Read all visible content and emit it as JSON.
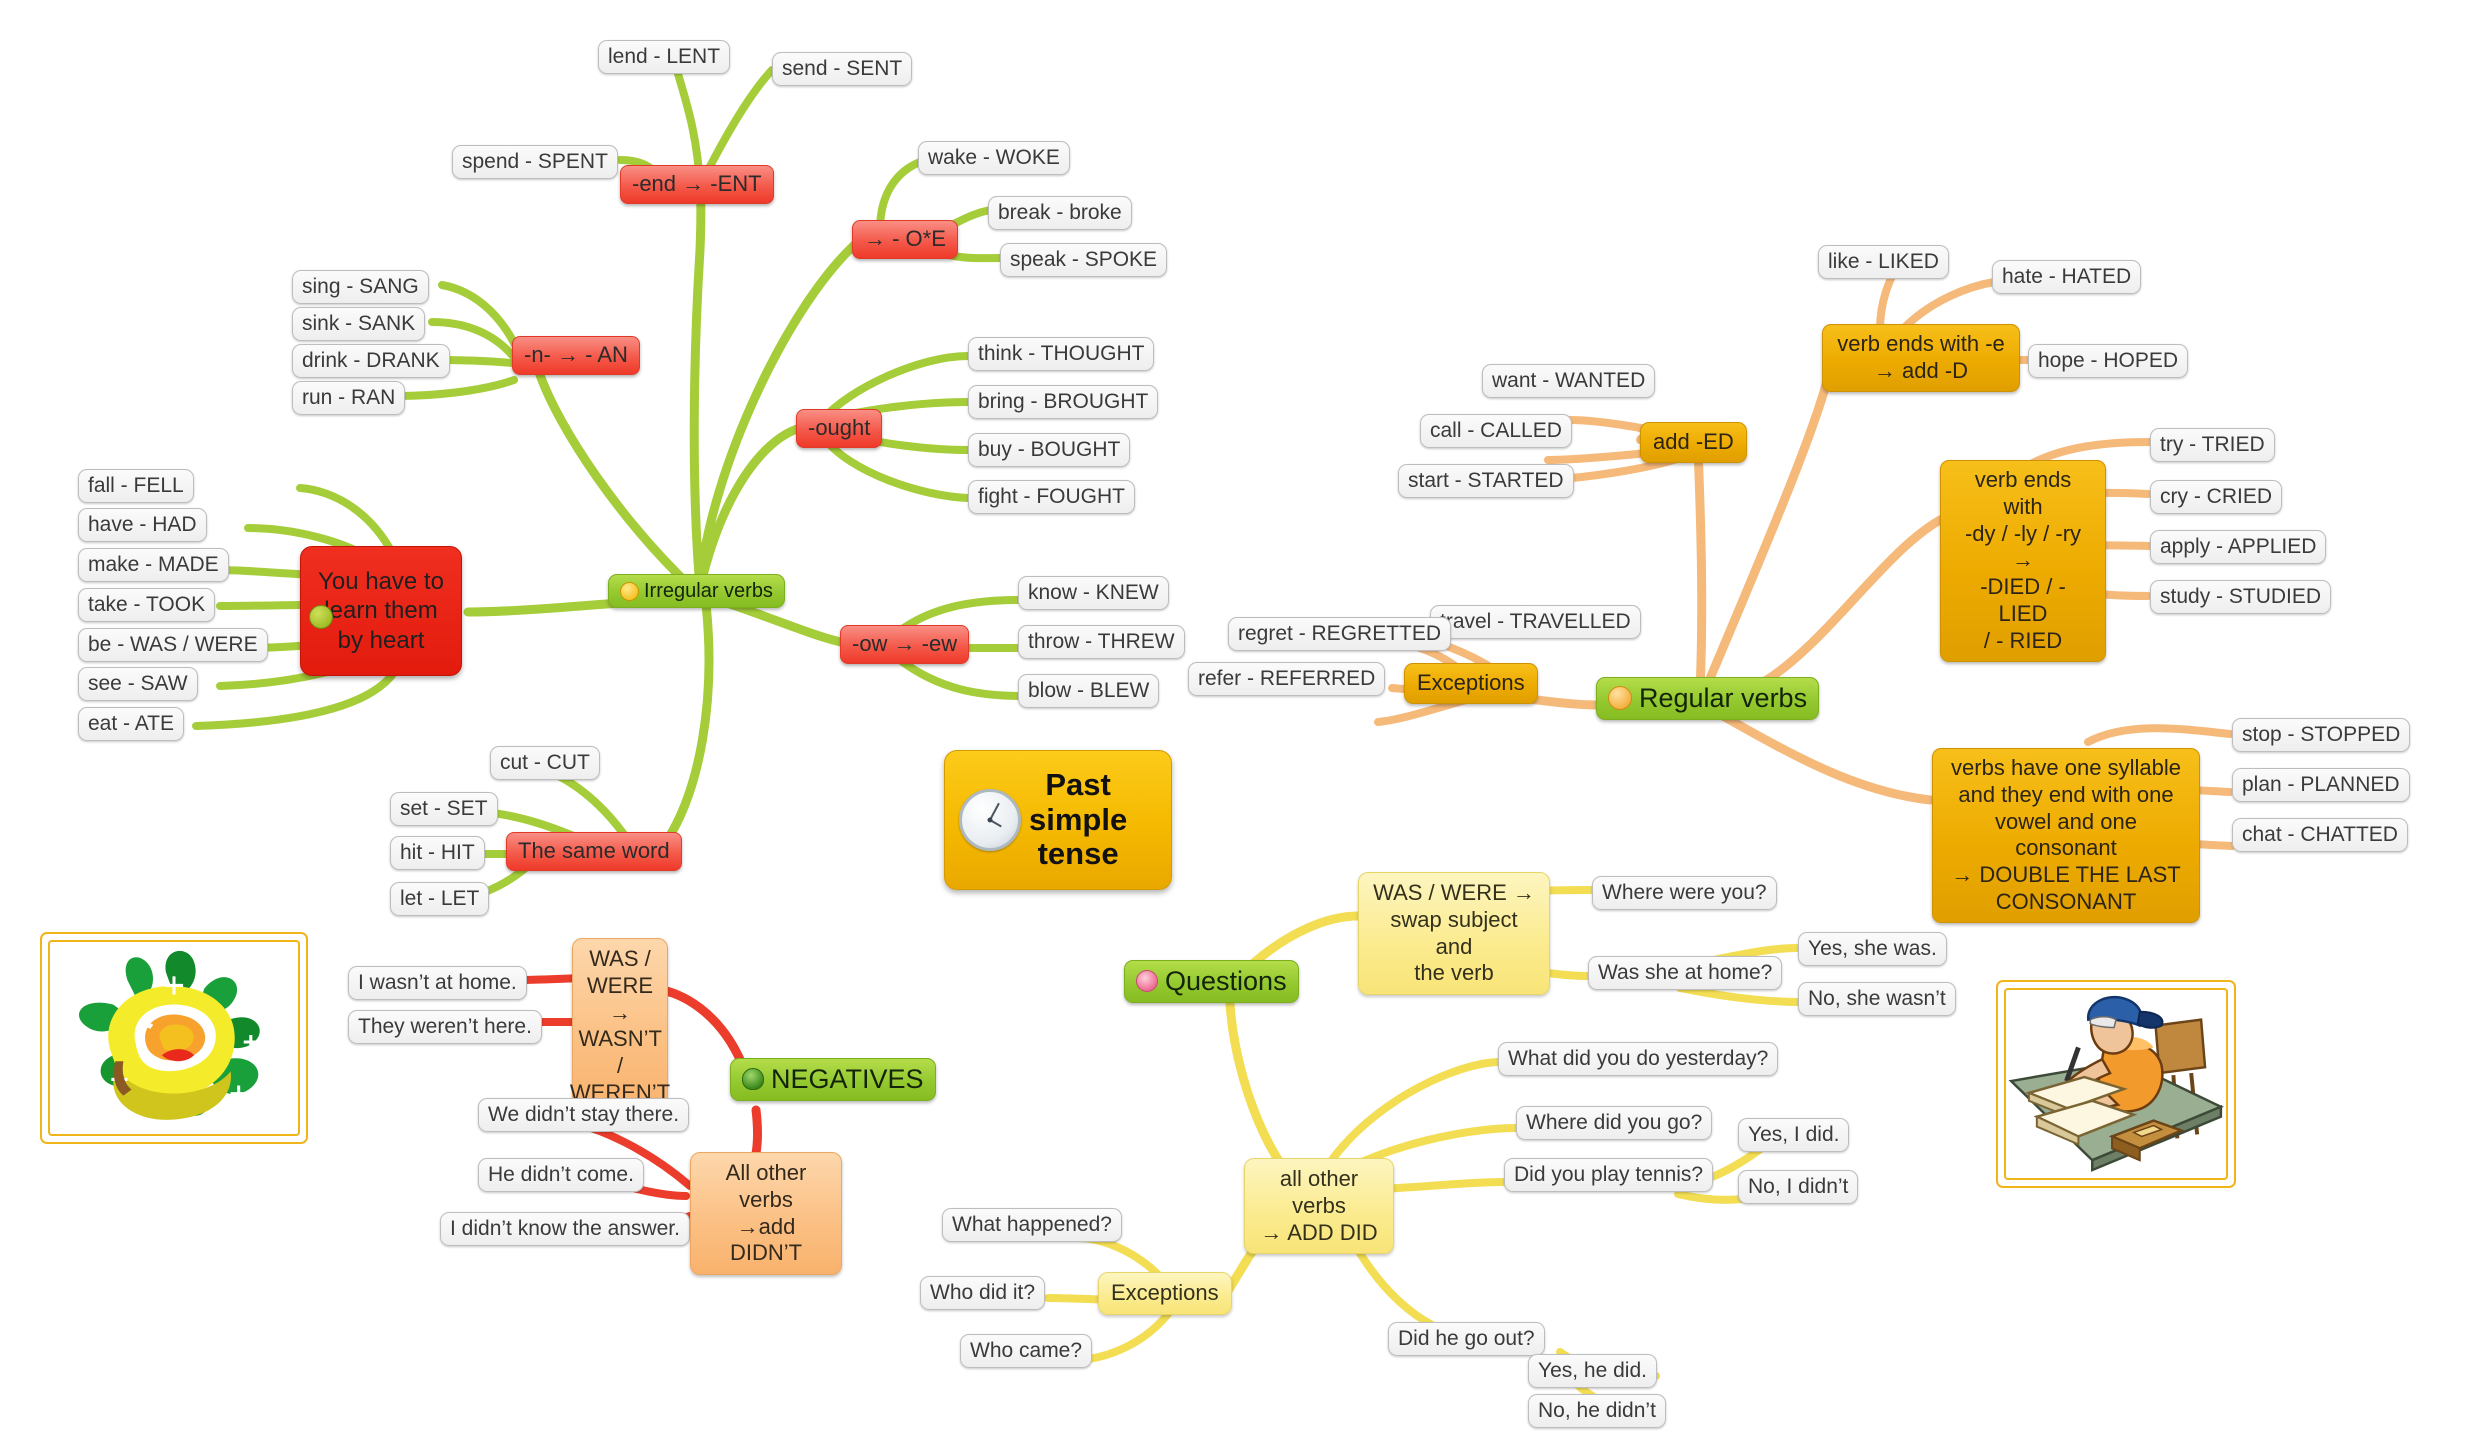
{
  "root": {
    "label": "Past simple tense",
    "icon": "clock-icon"
  },
  "branches": {
    "irregular": {
      "label": "Irregular verbs",
      "icon": "smiley-icon",
      "color": "#94c930",
      "groups": [
        {
          "label": "-end → -ENT",
          "children": [
            "lend - LENT",
            "send - SENT",
            "spend - SPENT"
          ]
        },
        {
          "label": "→ - O*E",
          "children": [
            "wake - WOKE",
            "break - broke",
            "speak - SPOKE"
          ]
        },
        {
          "label": "-n- → - AN",
          "children": [
            "sing - SANG",
            "sink - SANK",
            "drink - DRANK",
            "run - RAN"
          ]
        },
        {
          "label": "-ought",
          "children": [
            "think - THOUGHT",
            "bring - BROUGHT",
            "buy - BOUGHT",
            "fight - FOUGHT"
          ]
        },
        {
          "label": "You have to learn them by heart",
          "icon": "sad-face-icon",
          "children": [
            "fall - FELL",
            "have - HAD",
            "make - MADE",
            "take - TOOK",
            "be - WAS / WERE",
            "see - SAW",
            "eat - ATE"
          ]
        },
        {
          "label": "-ow → -ew",
          "children": [
            "know - KNEW",
            "throw - THREW",
            "blow - BLEW"
          ]
        },
        {
          "label": "The same word",
          "children": [
            "cut - CUT",
            "set - SET",
            "hit - HIT",
            "let - LET"
          ]
        }
      ]
    },
    "regular": {
      "label": "Regular verbs",
      "icon": "orange-ball-icon",
      "color": "#94c930",
      "groups": [
        {
          "label": "add -ED",
          "children": [
            "want - WANTED",
            "call - CALLED",
            "start - STARTED"
          ]
        },
        {
          "label": "verb ends with -e → add -D",
          "children": [
            "like - LIKED",
            "hate - HATED",
            "hope - HOPED"
          ]
        },
        {
          "label": "verb ends with -dy / -ly / -ry → -DIED / - LIED / - RIED",
          "children": [
            "try - TRIED",
            "cry - CRIED",
            "apply - APPLIED",
            "study - STUDIED"
          ]
        },
        {
          "label": "verbs have one syllable and they end with one vowel and one consonant → DOUBLE THE LAST CONSONANT",
          "children": [
            "stop - STOPPED",
            "plan - PLANNED",
            "chat - CHATTED"
          ]
        },
        {
          "label": "Exceptions",
          "children": [
            "travel - TRAVELLED",
            "regret - REGRETTED",
            "refer - REFERRED"
          ]
        }
      ]
    },
    "negatives": {
      "label": "NEGATIVES",
      "icon": "tree-icon",
      "color": "#94c930",
      "groups": [
        {
          "label": "WAS / WERE → WASN’T / WEREN’T",
          "children": [
            "I wasn’t at home.",
            "They weren’t here."
          ]
        },
        {
          "label": "All other verbs →add DIDN’T",
          "children": [
            "We didn’t stay there.",
            "He didn’t come.",
            "I didn’t know the answer."
          ]
        }
      ]
    },
    "questions": {
      "label": "Questions",
      "icon": "flower-icon",
      "color": "#94c930",
      "groups": [
        {
          "label": "WAS / WERE → swap subject and the verb",
          "children": [
            "Where were you?",
            "Was she at home?"
          ],
          "answers": [
            "Yes, she was.",
            "No, she wasn’t"
          ]
        },
        {
          "label": "all other verbs → ADD DID",
          "children": [
            "What did you do yesterday?",
            "Where did you go?",
            "Did you play tennis?",
            "Did he go out?"
          ],
          "answers": [
            "Yes, I did.",
            "No, I didn’t",
            "Yes, he did.",
            "No, he didn’t"
          ]
        },
        {
          "label": "Exceptions",
          "children": [
            "What happened?",
            "Who did it?",
            "Who came?"
          ]
        }
      ]
    }
  },
  "nodes": {
    "lend": "lend - LENT",
    "send": "send - SENT",
    "spend": "spend - SPENT",
    "end_ent": "-end → -ENT",
    "wake": "wake - WOKE",
    "break": "break - broke",
    "speak": "speak - SPOKE",
    "oe": "→ - O*E",
    "sing": "sing - SANG",
    "sink": "sink - SANK",
    "drink": "drink - DRANK",
    "run": "run - RAN",
    "n_an": "-n- → - AN",
    "think": "think - THOUGHT",
    "bring": "bring - BROUGHT",
    "buy": "buy - BOUGHT",
    "fight": "fight - FOUGHT",
    "ought": "-ought",
    "fall": "fall - FELL",
    "have": "have - HAD",
    "make": "make - MADE",
    "take": "take - TOOK",
    "be": "be - WAS / WERE",
    "see": "see - SAW",
    "eat": "eat - ATE",
    "byheart_l1": "You have to",
    "byheart_l2": "learn them",
    "byheart_l3": "by heart",
    "irregular": "Irregular verbs",
    "know": "know - KNEW",
    "throw": "throw - THREW",
    "blow": "blow - BLEW",
    "ow_ew": "-ow → -ew",
    "cut": "cut - CUT",
    "set": "set - SET",
    "hit": "hit - HIT",
    "let": "let - LET",
    "same_word": "The same word",
    "root_l1": "Past",
    "root_l2": "simple",
    "root_l3": "tense",
    "like": "like - LIKED",
    "hate": "hate - HATED",
    "hope": "hope - HOPED",
    "ends_e_l1": "verb ends with -e",
    "ends_e_l2": "→ add -D",
    "want": "want - WANTED",
    "call": "call - CALLED",
    "start": "start - STARTED",
    "add_ed": "add -ED",
    "try": "try - TRIED",
    "cry": "cry - CRIED",
    "apply": "apply - APPLIED",
    "study": "study - STUDIED",
    "dy_l1": "verb ends with",
    "dy_l2": "-dy / -ly / -ry →",
    "dy_l3": "-DIED / - LIED",
    "dy_l4": "/ - RIED",
    "travel": "travel - TRAVELLED",
    "regret": "regret - REGRETTED",
    "refer": "refer - REFERRED",
    "exceptions_reg": "Exceptions",
    "regular": "Regular verbs",
    "stop": "stop - STOPPED",
    "plan": "plan - PLANNED",
    "chat": "chat - CHATTED",
    "syll_l1": "verbs have one syllable",
    "syll_l2": "and they end with one",
    "syll_l3": "vowel and one consonant",
    "syll_l4": "→ DOUBLE THE LAST",
    "syll_l5": "CONSONANT",
    "was_swap_l1": "WAS / WERE →",
    "was_swap_l2": "swap subject and",
    "was_swap_l3": "the verb",
    "where_were": "Where were you?",
    "was_she": "Was she at home?",
    "yes_she_was": "Yes, she was.",
    "no_she_wasnt": "No, she wasn’t",
    "questions": "Questions",
    "what_did_yest": "What did you do yesterday?",
    "where_did_go": "Where did you go?",
    "did_play_tennis": "Did you play tennis?",
    "yes_i_did": "Yes, I did.",
    "no_i_didnt": "No, I didn’t",
    "allother_q_l1": "all other verbs",
    "allother_q_l2": "→ ADD DID",
    "did_he_go": "Did he go out?",
    "yes_he_did": "Yes, he did.",
    "no_he_didnt": "No, he didn’t",
    "what_happened": "What happened?",
    "who_did_it": "Who did it?",
    "who_came": "Who came?",
    "exceptions_q": "Exceptions",
    "neg_was_l1": "WAS /",
    "neg_was_l2": "WERE →",
    "neg_was_l3": "WASN’T /",
    "neg_was_l4": "WEREN’T",
    "i_wasnt": "I wasn’t at home.",
    "they_werent": "They weren’t here.",
    "negatives": "NEGATIVES",
    "we_didnt": "We didn’t stay there.",
    "he_didnt": "He didn’t come.",
    "i_didnt_know": "I didn’t know the answer.",
    "allother_n_l1": "All other verbs",
    "allother_n_l2": "→add DIDN’T"
  },
  "colors": {
    "irregular_link": "#a5cd39",
    "regular_link": "#f5b97a",
    "questions_link": "#f2dd53",
    "negatives_link": "#ec3c2c",
    "green_node": "#94c930",
    "amber_node": "#edab00",
    "red_node": "#ef3a2a",
    "pale_node": "#fbeb8e",
    "peach_node": "#fbbf82",
    "root_node": "#f5b900",
    "leaf_node": "#eeeeee"
  }
}
